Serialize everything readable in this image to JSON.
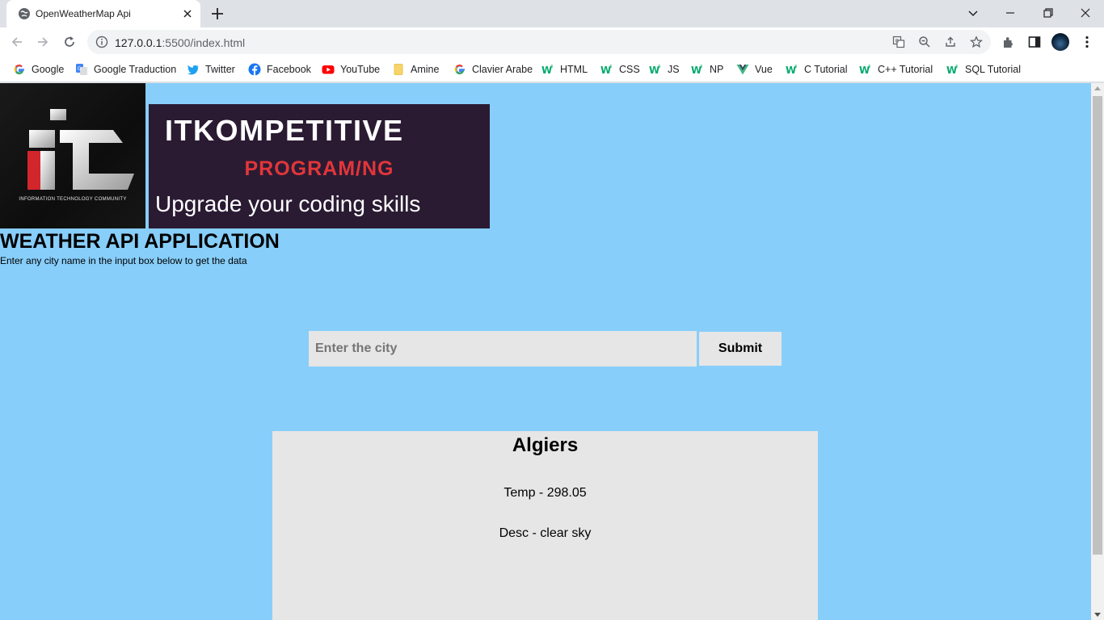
{
  "browser": {
    "tab_title": "OpenWeatherMap Api",
    "url_host": "127.0.0.1",
    "url_rest": ":5500/index.html",
    "bookmarks": [
      {
        "label": "Google",
        "icon": "google-icon"
      },
      {
        "label": "Google Traduction",
        "icon": "translate-icon"
      },
      {
        "label": "Twitter",
        "icon": "twitter-icon"
      },
      {
        "label": "Facebook",
        "icon": "facebook-icon"
      },
      {
        "label": "YouTube",
        "icon": "youtube-icon"
      },
      {
        "label": "Amine",
        "icon": "folder-icon"
      },
      {
        "label": "Clavier Arabe",
        "icon": "google-icon"
      },
      {
        "label": "HTML",
        "icon": "w3schools-icon"
      },
      {
        "label": "CSS",
        "icon": "w3schools-icon"
      },
      {
        "label": "JS",
        "icon": "w3schools-icon"
      },
      {
        "label": "NP",
        "icon": "w3schools-icon"
      },
      {
        "label": "Vue",
        "icon": "vue-icon"
      },
      {
        "label": "C Tutorial",
        "icon": "w3schools-icon"
      },
      {
        "label": "C++ Tutorial",
        "icon": "w3schools-icon"
      },
      {
        "label": "SQL Tutorial",
        "icon": "w3schools-icon"
      }
    ]
  },
  "page": {
    "logo_text": "INFORMATION TECHNOLOGY COMMUNITY",
    "banner": {
      "line1": "ITKOMPETITIVE",
      "line2": "PROGRAM/NG",
      "line3": "Upgrade your coding skills"
    },
    "title": "WEATHER API APPLICATION",
    "subtitle": "Enter any city name in the input box below to get the data",
    "search": {
      "placeholder": "Enter the city",
      "value": ""
    },
    "submit_label": "Submit",
    "result": {
      "city": "Algiers",
      "temp": "Temp - 298.05",
      "desc": "Desc - clear sky"
    }
  },
  "colors": {
    "page_background": "#87cefa",
    "card_background": "#e6e6e6",
    "banner_background": "#2a1b33",
    "banner_accent": "#e2363a"
  }
}
